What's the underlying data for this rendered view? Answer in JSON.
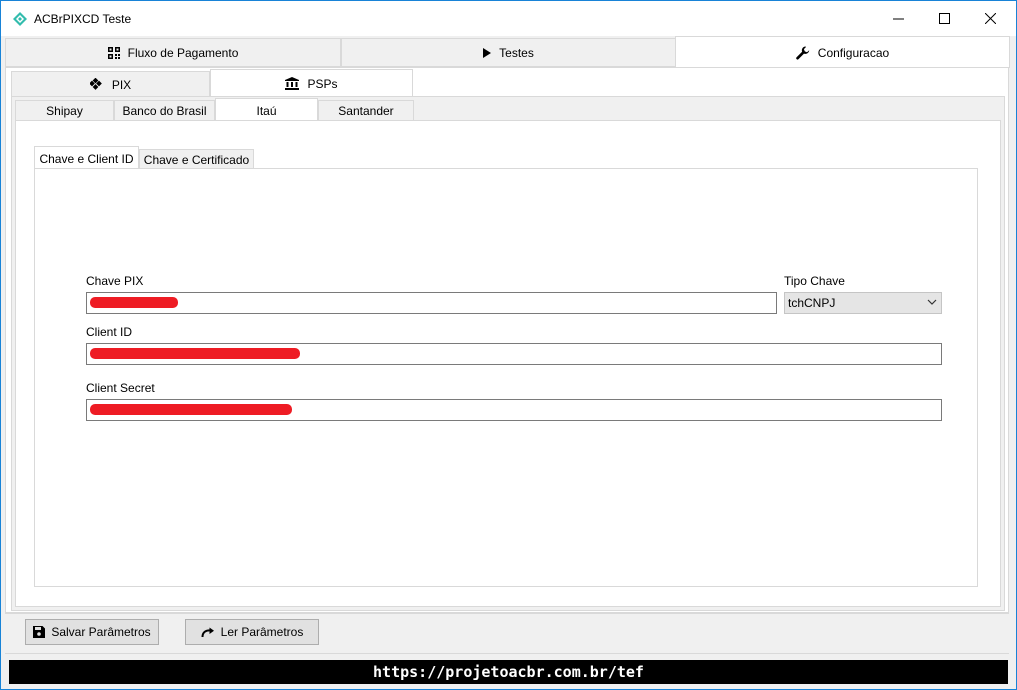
{
  "window": {
    "title": "ACBrPIXCD Teste"
  },
  "main_tabs": [
    {
      "label": "Fluxo de Pagamento",
      "icon": "qrcode-icon"
    },
    {
      "label": "Testes",
      "icon": "play-icon"
    },
    {
      "label": "Configuracao",
      "icon": "wrench-icon",
      "active": true
    }
  ],
  "config_tabs": [
    {
      "label": "PIX",
      "icon": "pix-icon"
    },
    {
      "label": "PSPs",
      "icon": "bank-icon",
      "active": true
    }
  ],
  "psp_tabs": [
    {
      "label": "Shipay"
    },
    {
      "label": "Banco do Brasil"
    },
    {
      "label": "Itaú",
      "active": true
    },
    {
      "label": "Santander"
    }
  ],
  "cred_tabs": [
    {
      "label": "Chave e Client ID",
      "active": true
    },
    {
      "label": "Chave  e Certificado"
    }
  ],
  "form": {
    "chave_pix_label": "Chave PIX",
    "tipo_chave_label": "Tipo Chave",
    "tipo_chave_value": "tchCNPJ",
    "client_id_label": "Client ID",
    "client_secret_label": "Client Secret"
  },
  "buttons": {
    "save_label": "Salvar Parâmetros",
    "load_label": "Ler Parâmetros"
  },
  "status": {
    "url": "https://projetoacbr.com.br/tef"
  },
  "colors": {
    "accent": "#1883d7",
    "redaction": "#ee1c24",
    "pix_icon": "#32bcad"
  }
}
